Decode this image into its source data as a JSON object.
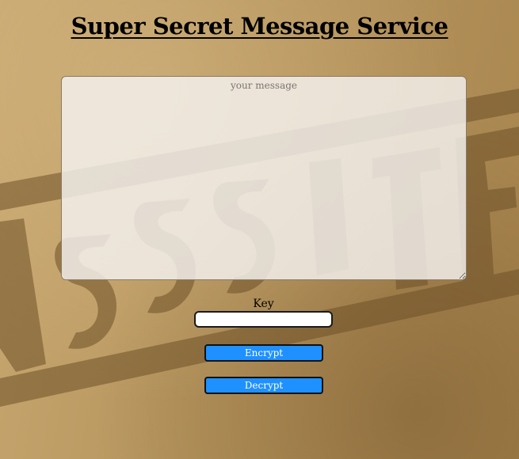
{
  "page": {
    "title": "Super Secret Message Service"
  },
  "message": {
    "placeholder": "your message",
    "value": ""
  },
  "key": {
    "label": "Key",
    "value": ""
  },
  "actions": {
    "encrypt_label": "Encrypt",
    "decrypt_label": "Decrypt"
  },
  "colors": {
    "background": "#b8975f",
    "stamp_ink": "#7a5c32",
    "button": "#1e90ff",
    "button_text": "#ffffff"
  }
}
